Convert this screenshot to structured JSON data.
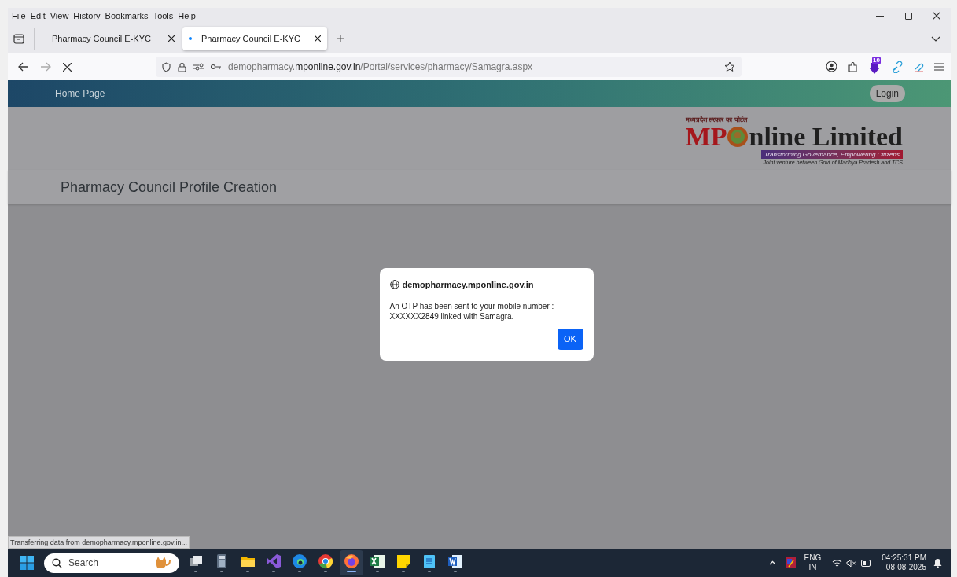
{
  "menu_bar": [
    "File",
    "Edit",
    "View",
    "History",
    "Bookmarks",
    "Tools",
    "Help"
  ],
  "tabs": [
    {
      "label": "Pharmacy Council E-KYC",
      "selected": false,
      "loading": false
    },
    {
      "label": "Pharmacy Council E-KYC",
      "selected": true,
      "loading": true
    }
  ],
  "address_bar": {
    "prefix": "demopharmacy.",
    "domain": "mponline.gov.in",
    "path": "/Portal/services/pharmacy/Samagra.aspx"
  },
  "toolbar": {
    "badge": "10"
  },
  "page": {
    "nav_link": "Home Page",
    "login_button": "Login",
    "logo": {
      "tagline_hindi": "मध्यप्रदेश सरकार का पोर्टल",
      "mp": "MP",
      "name": "nline Limited",
      "slogan": "Transforming Governance, Empowering Citizens",
      "subtitle": "Joint venture between Govt of Madhya Pradesh and TCS"
    },
    "heading": "Pharmacy Council Profile Creation"
  },
  "dialog": {
    "origin": "demopharmacy.mponline.gov.in",
    "message": "An OTP has been sent to your mobile number : XXXXXX2849 linked with Samagra.",
    "ok_button": "OK"
  },
  "status_text": "Transferring data from demopharmacy.mponline.gov.in...",
  "taskbar": {
    "search_placeholder": "Search",
    "apps": [
      {
        "kind": "taskview",
        "active": false
      },
      {
        "kind": "calculator",
        "active": false
      },
      {
        "kind": "explorer",
        "active": false
      },
      {
        "kind": "visualstudio",
        "active": false
      },
      {
        "kind": "edge",
        "active": false
      },
      {
        "kind": "chrome",
        "active": false
      },
      {
        "kind": "firefox",
        "active": true
      },
      {
        "kind": "excel",
        "active": false
      },
      {
        "kind": "notes",
        "active": false
      },
      {
        "kind": "notepad",
        "active": false
      },
      {
        "kind": "word",
        "active": false
      }
    ],
    "language": "ENG",
    "region": "IN",
    "time": "04:25:31 PM",
    "date": "08-08-2025"
  }
}
